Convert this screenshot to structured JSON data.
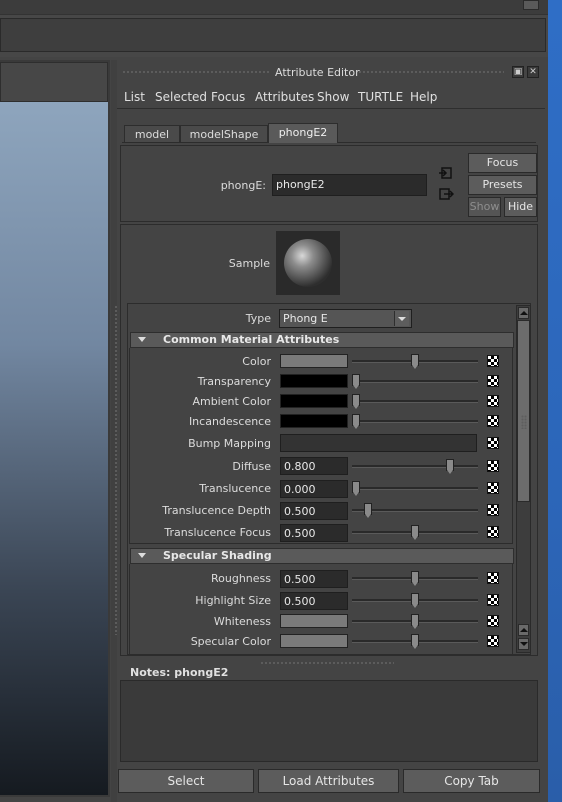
{
  "window": {
    "title": "Attribute Editor"
  },
  "menu": [
    "List",
    "Selected",
    "Focus",
    "Attributes",
    "Show",
    "TURTLE",
    "Help"
  ],
  "tabs": [
    "model",
    "modelShape",
    "phongE2"
  ],
  "header": {
    "node_label": "phongE:",
    "node_value": "phongE2",
    "focus_label": "Focus",
    "presets_label": "Presets",
    "show_label": "Show",
    "hide_label": "Hide"
  },
  "sample": {
    "label": "Sample"
  },
  "type_row": {
    "label": "Type",
    "value": "Phong E"
  },
  "sections": {
    "common": "Common Material Attributes",
    "specular": "Specular Shading"
  },
  "attributes": {
    "color": {
      "label": "Color",
      "swatch": "#7a7a7a",
      "slider": 0.5
    },
    "transparency": {
      "label": "Transparency",
      "swatch": "#000000",
      "slider": 0.0
    },
    "ambient": {
      "label": "Ambient Color",
      "swatch": "#000000",
      "slider": 0.0
    },
    "incandescence": {
      "label": "Incandescence",
      "swatch": "#000000",
      "slider": 0.0
    },
    "bump": {
      "label": "Bump Mapping"
    },
    "diffuse": {
      "label": "Diffuse",
      "value": "0.800",
      "slider": 0.8
    },
    "translucence": {
      "label": "Translucence",
      "value": "0.000",
      "slider": 0.0
    },
    "trans_depth": {
      "label": "Translucence Depth",
      "value": "0.500",
      "slider": 0.1
    },
    "trans_focus": {
      "label": "Translucence Focus",
      "value": "0.500",
      "slider": 0.5
    },
    "roughness": {
      "label": "Roughness",
      "value": "0.500",
      "slider": 0.5
    },
    "highlight": {
      "label": "Highlight Size",
      "value": "0.500",
      "slider": 0.5
    },
    "whiteness": {
      "label": "Whiteness",
      "swatch": "#7a7a7a",
      "slider": 0.5
    },
    "spec_color": {
      "label": "Specular Color",
      "swatch": "#7a7a7a",
      "slider": 0.5
    }
  },
  "notes": {
    "label": "Notes:  phongE2"
  },
  "footer": {
    "select": "Select",
    "load": "Load Attributes",
    "copy": "Copy Tab"
  },
  "colors": {
    "accent_blue": "#2c66b9",
    "panel_bg": "#444444",
    "field_bg": "#2b2b2b"
  }
}
